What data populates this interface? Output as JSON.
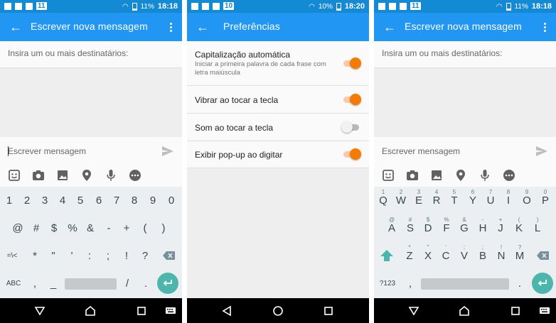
{
  "colors": {
    "status_bar": "#1489d4",
    "toolbar": "#2196f3",
    "accent": "#f57c00",
    "enter_key": "#4db6ac"
  },
  "screen1": {
    "status": {
      "notification_count": "11",
      "battery": "11%",
      "time": "18:18"
    },
    "toolbar": {
      "title": "Escrever nova mensagem"
    },
    "recipient": {
      "placeholder": "Insira um ou mais destinatários:"
    },
    "compose": {
      "placeholder": "Escrever mensagem"
    },
    "emoji_row": [
      "sticker-icon",
      "camera-icon",
      "image-icon",
      "location-icon",
      "microphone-icon",
      "more-circle-icon"
    ],
    "keyboard": {
      "row1": [
        "1",
        "2",
        "3",
        "4",
        "5",
        "6",
        "7",
        "8",
        "9",
        "0"
      ],
      "row2": [
        "@",
        "#",
        "$",
        "%",
        "&",
        "-",
        "+",
        "(",
        ")"
      ],
      "row3_left": "=\\<",
      "row3": [
        "*",
        "\"",
        "'",
        ":",
        ";",
        "!",
        "?"
      ],
      "row4_left": "ABC",
      "row4": [
        ",",
        "_",
        "/",
        "."
      ]
    }
  },
  "screen2": {
    "status": {
      "notification_count": "10",
      "battery": "10%",
      "time": "18:20"
    },
    "toolbar": {
      "title": "Preferências"
    },
    "prefs": [
      {
        "title": "Capitalização automática",
        "subtitle": "Iniciar a primeira palavra de cada frase com letra maiúscula",
        "enabled": true
      },
      {
        "title": "Vibrar ao tocar a tecla",
        "subtitle": "",
        "enabled": true
      },
      {
        "title": "Som ao tocar a tecla",
        "subtitle": "",
        "enabled": false
      },
      {
        "title": "Exibir pop-up ao digitar",
        "subtitle": "",
        "enabled": true
      }
    ]
  },
  "screen3": {
    "status": {
      "notification_count": "11",
      "battery": "11%",
      "time": "18:18"
    },
    "toolbar": {
      "title": "Escrever nova mensagem"
    },
    "recipient": {
      "placeholder": "Insira um ou mais destinatários:"
    },
    "compose": {
      "placeholder": "Escrever mensagem"
    },
    "keyboard": {
      "row1": [
        "Q",
        "W",
        "E",
        "R",
        "T",
        "Y",
        "U",
        "I",
        "O",
        "P"
      ],
      "row1_hints": [
        "1",
        "2",
        "3",
        "4",
        "5",
        "6",
        "7",
        "8",
        "9",
        "0"
      ],
      "row2": [
        "A",
        "S",
        "D",
        "F",
        "G",
        "H",
        "J",
        "K",
        "L"
      ],
      "row2_hints": [
        "@",
        "#",
        "$",
        "%",
        "&",
        "-",
        "+",
        "(",
        ")"
      ],
      "row3": [
        "Z",
        "X",
        "C",
        "V",
        "B",
        "N",
        "M"
      ],
      "row3_hints": [
        "*",
        "\"",
        "'",
        ":",
        ";",
        "!",
        "?"
      ],
      "row4_left": "?123",
      "row4": [
        ",",
        "."
      ]
    }
  }
}
